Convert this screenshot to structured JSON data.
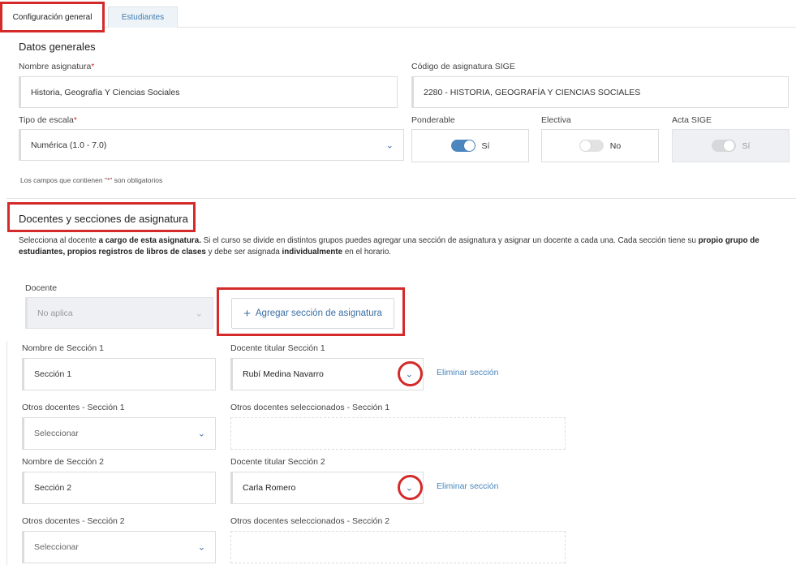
{
  "tabs": [
    {
      "label": "Configuración general",
      "active": true
    },
    {
      "label": "Estudiantes",
      "active": false
    }
  ],
  "general": {
    "title": "Datos generales",
    "nombre_label": "Nombre asignatura",
    "nombre_value": "Historia, Geografía Y Ciencias Sociales",
    "codigo_label": "Código de asignatura SIGE",
    "codigo_value": "2280 - HISTORIA, GEOGRAFÍA Y CIENCIAS SOCIALES",
    "escala_label": "Tipo de escala",
    "escala_value": "Numérica (1.0 - 7.0)",
    "required_mark": "*",
    "ponderable_label": "Ponderable",
    "ponderable_value": "Sí",
    "electiva_label": "Electiva",
    "electiva_value": "No",
    "acta_label": "Acta SIGE",
    "acta_value": "Sí",
    "note_prefix": "Los campos que contienen \"",
    "note_mark": "*",
    "note_suffix": "\" son obligatorios"
  },
  "docentes": {
    "title": "Docentes y secciones de asignatura",
    "desc_parts": [
      "Selecciona al docente ",
      "a cargo de esta asignatura.",
      " Si el curso se divide en distintos grupos puedes agregar una sección de asignatura y asignar un docente a cada una. Cada sección tiene su ",
      "propio grupo de estudiantes, propios registros de libros de clases",
      " y debe ser asignada ",
      "individualmente",
      " en el horario."
    ],
    "docente_label": "Docente",
    "docente_value": "No aplica",
    "add_label": "Agregar sección de asignatura",
    "add_icon": "+"
  },
  "sections": [
    {
      "nombre_label": "Nombre de Sección 1",
      "nombre_value": "Sección 1",
      "titular_label": "Docente titular Sección 1",
      "titular_value": "Rubí Medina Navarro",
      "eliminar": "Eliminar sección",
      "otros_label": "Otros docentes - Sección 1",
      "otros_placeholder": "Seleccionar",
      "otros_sel_label": "Otros docentes seleccionados - Sección 1"
    },
    {
      "nombre_label": "Nombre de Sección 2",
      "nombre_value": "Sección 2",
      "titular_label": "Docente titular Sección 2",
      "titular_value": "Carla Romero",
      "eliminar": "Eliminar sección",
      "otros_label": "Otros docentes - Sección 2",
      "otros_placeholder": "Seleccionar",
      "otros_sel_label": "Otros docentes seleccionados - Sección 2"
    }
  ],
  "icons": {
    "chevron": "⌄"
  },
  "colors": {
    "accent": "#4b87be",
    "link": "#4a86ba",
    "highlight": "#d42a2a"
  }
}
